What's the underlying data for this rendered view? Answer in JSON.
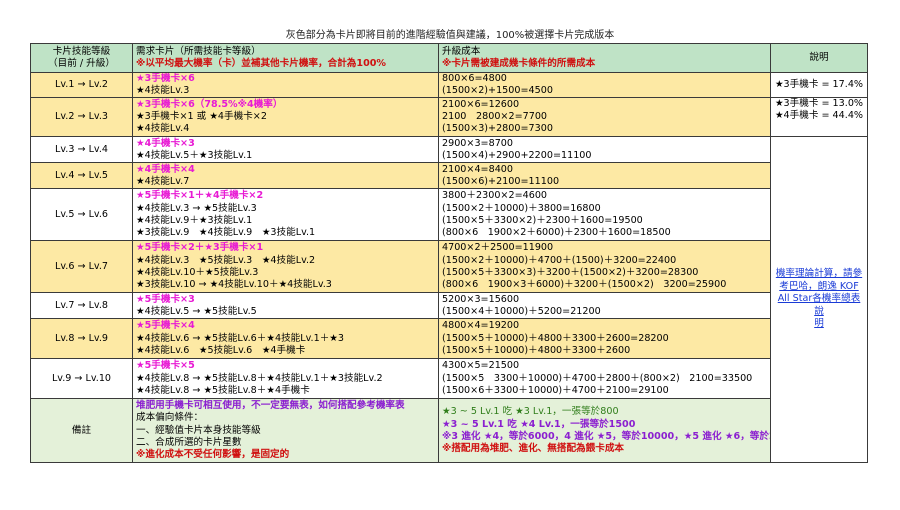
{
  "title": "灰色部分為卡片即將目前的進階經驗值與建議，100%被選擇卡片完成版本",
  "headers": {
    "col1": [
      "卡片技能等級",
      "（目前 / 升級）"
    ],
    "col2_line1": "需求卡片（所需技能卡等級）",
    "col2_line2": "※以平均最大機率（卡）並補其他卡片機率，合計為100%",
    "col3_line1": "升級成本",
    "col3_line2": "※卡片需被建成幾卡條件的所需成本",
    "col4": "說明"
  },
  "rows": [
    {
      "level": "Lv.1 → Lv.2",
      "shade": "y",
      "req": [
        {
          "t": "★3手機卡×6",
          "c": "pink"
        },
        {
          "t": "★4技能Lv.3"
        }
      ],
      "cost": [
        {
          "t": "800×6=4800"
        },
        {
          "t": "(1500×2)+1500=4500"
        }
      ]
    },
    {
      "level": "Lv.2 → Lv.3",
      "shade": "y",
      "req": [
        {
          "t": "★3手機卡×6（78.5%※4機率）",
          "c": "pink"
        },
        {
          "t": "★3手機卡×1 或 ★4手機卡×2"
        },
        {
          "t": "★4技能Lv.4"
        }
      ],
      "cost": [
        {
          "t": "2100×6=12600"
        },
        {
          "t": "2100　2800×2=7700"
        },
        {
          "t": "(1500×3)+2800=7300"
        }
      ]
    },
    {
      "level": "Lv.3 → Lv.4",
      "shade": "w",
      "req": [
        {
          "t": "★4手機卡×3",
          "c": "pink"
        },
        {
          "t": "★4技能Lv.5＋★3技能Lv.1"
        }
      ],
      "cost": [
        {
          "t": "2900×3=8700"
        },
        {
          "t": "(1500×4)+2900+2200=11100"
        }
      ]
    },
    {
      "level": "Lv.4 → Lv.5",
      "shade": "y",
      "req": [
        {
          "t": "★4手機卡×4",
          "c": "pink"
        },
        {
          "t": "★4技能Lv.7"
        }
      ],
      "cost": [
        {
          "t": "2100×4=8400"
        },
        {
          "t": "(1500×6)+2100=11100"
        }
      ]
    },
    {
      "level": "Lv.5 → Lv.6",
      "shade": "w",
      "req": [
        {
          "t": "★5手機卡×1＋★4手機卡×2",
          "c": "pink"
        },
        {
          "t": "★4技能Lv.3 → ★5技能Lv.3"
        },
        {
          "t": "★4技能Lv.9＋★3技能Lv.1"
        },
        {
          "t": "★3技能Lv.9　★4技能Lv.9　★3技能Lv.1"
        }
      ],
      "cost": [
        {
          "t": "3800＋2300×2=4600"
        },
        {
          "t": "(1500×2＋10000)＋3800=16800"
        },
        {
          "t": "(1500×5＋3300×2)＋2300＋1600=19500"
        },
        {
          "t": "(800×6　1900×2＋6000)＋2300＋1600=18500"
        }
      ]
    },
    {
      "level": "Lv.6 → Lv.7",
      "shade": "y",
      "req": [
        {
          "t": "★5手機卡×2＋★3手機卡×1",
          "c": "pink"
        },
        {
          "t": "★4技能Lv.3　★5技能Lv.3　★4技能Lv.2"
        },
        {
          "t": "★4技能Lv.10＋★5技能Lv.3"
        },
        {
          "t": "★3技能Lv.10 → ★4技能Lv.10＋★4技能Lv.3"
        }
      ],
      "cost": [
        {
          "t": "4700×2＋2500=11900"
        },
        {
          "t": "(1500×2＋10000)＋4700＋(1500)＋3200=22400"
        },
        {
          "t": "(1500×5＋3300×3)＋3200＋(1500×2)＋3200=28300"
        },
        {
          "t": "(800×6　1900×3＋6000)＋3200＋(1500×2)　3200=25900"
        }
      ]
    },
    {
      "level": "Lv.7 → Lv.8",
      "shade": "w",
      "req": [
        {
          "t": "★5手機卡×3",
          "c": "pink"
        },
        {
          "t": "★4技能Lv.5 → ★5技能Lv.5"
        }
      ],
      "cost": [
        {
          "t": "5200×3=15600"
        },
        {
          "t": "(1500×4＋10000)＋5200=21200"
        }
      ]
    },
    {
      "level": "Lv.8 → Lv.9",
      "shade": "y",
      "req": [
        {
          "t": "★5手機卡×4",
          "c": "pink"
        },
        {
          "t": "★4技能Lv.6 → ★5技能Lv.6＋★4技能Lv.1＋★3"
        },
        {
          "t": "★4技能Lv.6　★5技能Lv.6　★4手機卡"
        }
      ],
      "cost": [
        {
          "t": "4800×4=19200"
        },
        {
          "t": "(1500×5＋10000)＋4800＋3300＋2600=28200"
        },
        {
          "t": "(1500×5＋10000)＋4800＋3300＋2600"
        }
      ]
    },
    {
      "level": "Lv.9 → Lv.10",
      "shade": "w",
      "req": [
        {
          "t": "★5手機卡×5",
          "c": "pink"
        },
        {
          "t": "★4技能Lv.8 → ★5技能Lv.8＋★4技能Lv.1＋★3技能Lv.2"
        },
        {
          "t": "★4技能Lv.8 → ★5技能Lv.8＋★4手機卡"
        }
      ],
      "cost": [
        {
          "t": "4300×5=21500"
        },
        {
          "t": "(1500×5　3300＋10000)＋4700＋2800＋(800×2)　2100=33500"
        },
        {
          "t": "(1500×6＋3300＋10000)＋4700＋2100=29100"
        }
      ]
    },
    {
      "level": "備註",
      "shade": "g",
      "req": [
        {
          "t": "堆肥用手機卡可相互使用，不一定要無表，如何搭配參考機率表",
          "c": "purple"
        },
        {
          "t": "成本偏向條件："
        },
        {
          "t": "一、經驗值卡片本身技能等級"
        },
        {
          "t": "二、合成所選的卡片星數"
        },
        {
          "t": "※進化成本不受任何影響，是固定的",
          "c": "red"
        }
      ],
      "cost": [
        {
          "t": "★3 ~ 5 Lv.1 吃 ★3 Lv.1，一張等於800",
          "c": "green"
        },
        {
          "t": "★3 ~ 5 Lv.1 吃 ★4 Lv.1，一張等於1500",
          "c": "purple"
        },
        {
          "t": "※3 進化 ★4，等於6000，4 進化 ★5，等於10000，★5 進化 ★6，等於20000",
          "c": "purple"
        },
        {
          "t": "※搭配用為堆肥、進化、無搭配為餵卡成本",
          "c": "red"
        }
      ]
    }
  ],
  "notes": {
    "n1": "★3手機卡 = 17.4%",
    "n2a": "★3手機卡 = 13.0%",
    "n2b": "★4手機卡 = 44.4%",
    "link_lines": [
      "機率理論計算，請參",
      "考巴哈，朗逸 KOF",
      "All Star各機率總表說",
      "明"
    ]
  }
}
